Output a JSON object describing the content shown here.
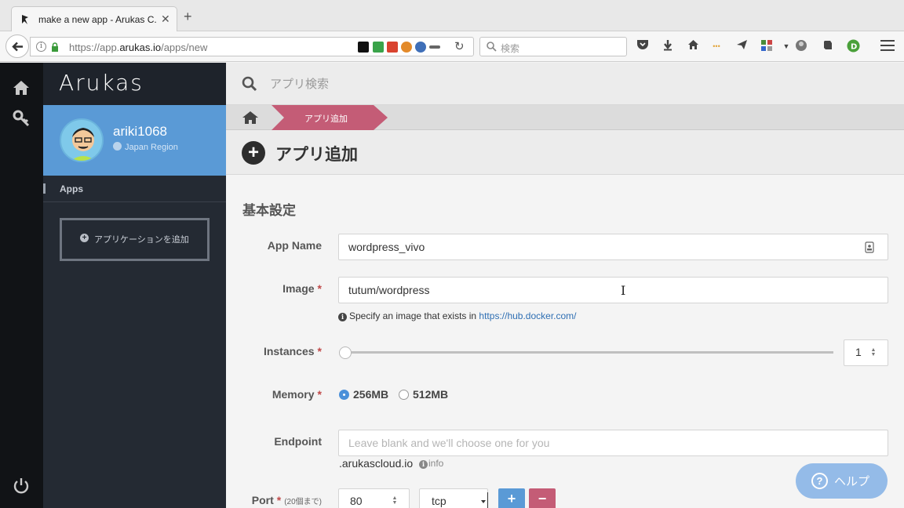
{
  "browser": {
    "tab_title": "make a new app - Arukas C...",
    "url_prefix": "https://app.",
    "url_domain": "arukas.io",
    "url_path": "/apps/new",
    "search_placeholder": "検索"
  },
  "sidebar": {
    "logo": "Arukas",
    "username": "ariki1068",
    "region": "Japan Region",
    "nav_apps": "Apps",
    "add_app_label": "アプリケーションを追加"
  },
  "main": {
    "search_placeholder": "アプリ検索",
    "breadcrumb_active": "アプリ追加",
    "page_title": "アプリ追加",
    "section_title": "基本設定"
  },
  "form": {
    "app_name": {
      "label": "App Name",
      "value": "wordpress_vivo"
    },
    "image": {
      "label": "Image",
      "required_mark": "*",
      "value": "tutum/wordpress",
      "help_text": "Specify an image that exists in ",
      "help_link": "https://hub.docker.com/"
    },
    "instances": {
      "label": "Instances",
      "required_mark": "*",
      "value": "1",
      "slider_position": 0.0
    },
    "memory": {
      "label": "Memory",
      "required_mark": "*",
      "options": [
        "256MB",
        "512MB"
      ],
      "selected": "256MB"
    },
    "endpoint": {
      "label": "Endpoint",
      "placeholder": "Leave blank and we'll choose one for you",
      "suffix": ".arukascloud.io",
      "info": "info"
    },
    "port": {
      "label": "Port",
      "required_mark": "*",
      "note": "(20個まで)",
      "value": "80",
      "protocol": "tcp",
      "add_label": "+",
      "remove_label": "−"
    }
  },
  "help_button": {
    "label": "ヘルプ",
    "icon": "?"
  },
  "colors": {
    "accent": "#5a9ad6",
    "breadcrumb": "#c45c76",
    "sidebar": "#242a33"
  }
}
